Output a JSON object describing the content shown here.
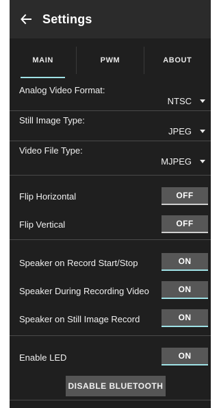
{
  "header": {
    "back_icon": "arrow-left-icon",
    "title": "Settings"
  },
  "tabs": [
    {
      "label": "MAIN",
      "active": true
    },
    {
      "label": "PWM",
      "active": false
    },
    {
      "label": "ABOUT",
      "active": false
    }
  ],
  "dropdowns": [
    {
      "label": "Analog Video Format:",
      "value": "NTSC"
    },
    {
      "label": "Still Image Type:",
      "value": "JPEG"
    },
    {
      "label": "Video File Type:",
      "value": "MJPEG"
    }
  ],
  "toggles": [
    {
      "label": "Flip Horizontal",
      "state": "OFF"
    },
    {
      "label": "Flip Vertical",
      "state": "OFF"
    },
    {
      "label": "Speaker on Record Start/Stop",
      "state": "ON"
    },
    {
      "label": "Speaker During Recording Video",
      "state": "ON"
    },
    {
      "label": "Speaker on Still Image Record",
      "state": "ON"
    },
    {
      "label": "Enable LED",
      "state": "ON"
    }
  ],
  "actions": {
    "disable_bluetooth": "DISABLE BLUETOOTH"
  },
  "colors": {
    "background": "#1f1f1f",
    "appbar": "#2b2b2b",
    "accent": "#9fe2e6",
    "toggle_bg": "#575757"
  }
}
